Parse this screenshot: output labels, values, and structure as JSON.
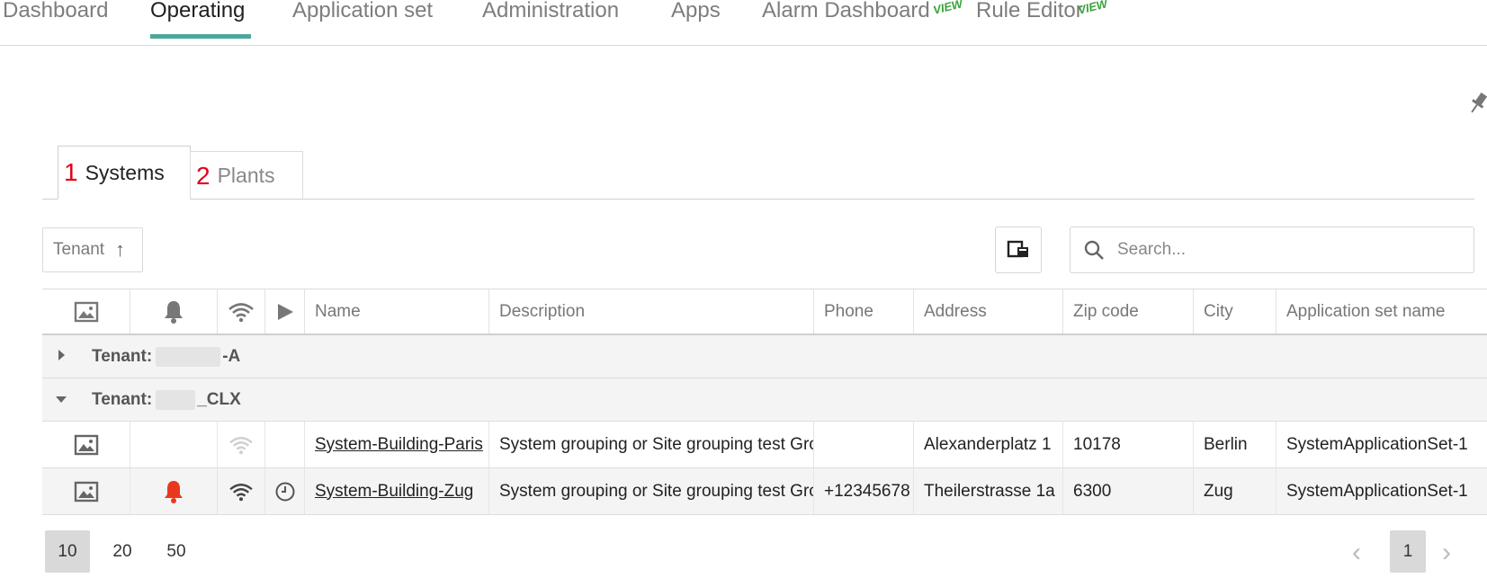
{
  "nav": {
    "items": [
      "Dashboard",
      "Operating",
      "Application set",
      "Administration",
      "Apps",
      "Alarm Dashboard",
      "Rule Editor"
    ],
    "active": "Operating",
    "preview_badge": "VIEW",
    "preview_badge_2": "VIEW"
  },
  "tabs": [
    {
      "number": "1",
      "label": "Systems"
    },
    {
      "number": "2",
      "label": "Plants"
    }
  ],
  "toolbar": {
    "sort_label": "Tenant",
    "sort_arrow": "↑",
    "search_placeholder": "Search..."
  },
  "table": {
    "columns": [
      "Name",
      "Description",
      "Phone",
      "Address",
      "Zip code",
      "City",
      "Application set name"
    ],
    "groups": [
      {
        "prefix": "Tenant:",
        "suffix": "-A",
        "expanded": false
      },
      {
        "prefix": "Tenant:",
        "suffix": "_CLX",
        "expanded": true
      }
    ],
    "rows": [
      {
        "name": "System-Building-Paris",
        "description": "System grouping or Site grouping test Gro",
        "phone": "",
        "address": "Alexanderplatz 1",
        "zip": "10178",
        "city": "Berlin",
        "appset": "SystemApplicationSet-1",
        "alarm": false,
        "online": false,
        "scheduled": false
      },
      {
        "name": "System-Building-Zug",
        "description": "System grouping or Site grouping test Gro",
        "phone": "+12345678",
        "address": "Theilerstrasse 1a",
        "zip": "6300",
        "city": "Zug",
        "appset": "SystemApplicationSet-1",
        "alarm": true,
        "online": true,
        "scheduled": true
      }
    ]
  },
  "pagination": {
    "sizes": [
      "10",
      "20",
      "50"
    ],
    "active_size": "10",
    "current_page": "1"
  },
  "colors": {
    "accent": "#4da89c",
    "alarm": "#e8391e",
    "tab_number": "#e2001a",
    "preview": "#3aa33a"
  }
}
